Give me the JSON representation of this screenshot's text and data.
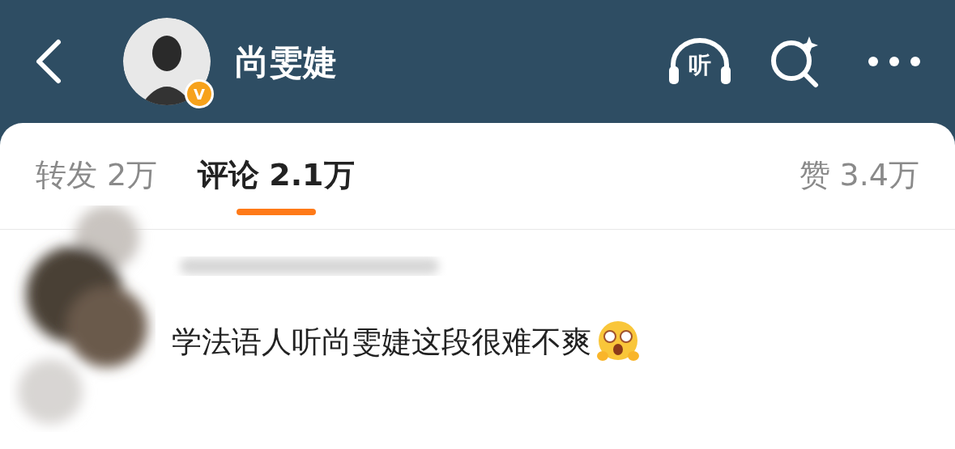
{
  "header": {
    "title": "尚雯婕",
    "verified_badge": "V",
    "listen_label": "听"
  },
  "tabs": [
    {
      "label": "转发",
      "count": "2万",
      "selected": false
    },
    {
      "label": "评论",
      "count": "2.1万",
      "selected": true
    },
    {
      "label": "赞",
      "count": "3.4万",
      "selected": false
    }
  ],
  "comments": [
    {
      "text": "学法语人听尚雯婕这段很难不爽"
    }
  ]
}
